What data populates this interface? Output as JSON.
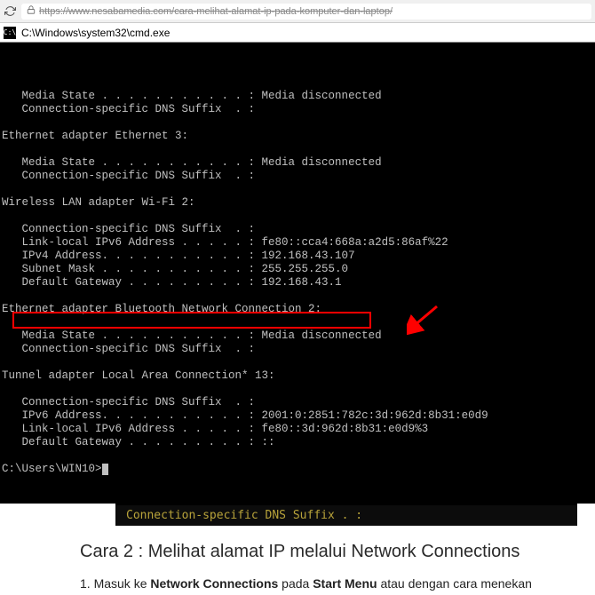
{
  "browser": {
    "url": "https://www.nesabamedia.com/cara-melihat-alamat-ip-pada-komputer-dan-laptop/"
  },
  "cmd": {
    "title": "C:\\Windows\\system32\\cmd.exe",
    "lines": [
      "",
      "   Media State . . . . . . . . . . . : Media disconnected",
      "   Connection-specific DNS Suffix  . :",
      "",
      "Ethernet adapter Ethernet 3:",
      "",
      "   Media State . . . . . . . . . . . : Media disconnected",
      "   Connection-specific DNS Suffix  . :",
      "",
      "Wireless LAN adapter Wi-Fi 2:",
      "",
      "   Connection-specific DNS Suffix  . :",
      "   Link-local IPv6 Address . . . . . : fe80::cca4:668a:a2d5:86af%22",
      "   IPv4 Address. . . . . . . . . . . : 192.168.43.107",
      "   Subnet Mask . . . . . . . . . . . : 255.255.255.0",
      "   Default Gateway . . . . . . . . . : 192.168.43.1",
      "",
      "Ethernet adapter Bluetooth Network Connection 2:",
      "",
      "   Media State . . . . . . . . . . . : Media disconnected",
      "   Connection-specific DNS Suffix  . :",
      "",
      "Tunnel adapter Local Area Connection* 13:",
      "",
      "   Connection-specific DNS Suffix  . :",
      "   IPv6 Address. . . . . . . . . . . : 2001:0:2851:782c:3d:962d:8b31:e0d9",
      "   Link-local IPv6 Address . . . . . : fe80::3d:962d:8b31:e0d9%3",
      "   Default Gateway . . . . . . . . . : ::",
      "",
      "C:\\Users\\WIN10>"
    ]
  },
  "sub_terminal": {
    "text": "Connection-specific DNS Suffix  . :"
  },
  "page": {
    "heading": "Cara 2 : Melihat alamat IP melalui Network Connections",
    "step1_prefix": "1. Masuk ke ",
    "step1_bold1": "Network Connections",
    "step1_mid": " pada ",
    "step1_bold2": "Start Menu",
    "step1_suffix": " atau dengan cara menekan "
  }
}
